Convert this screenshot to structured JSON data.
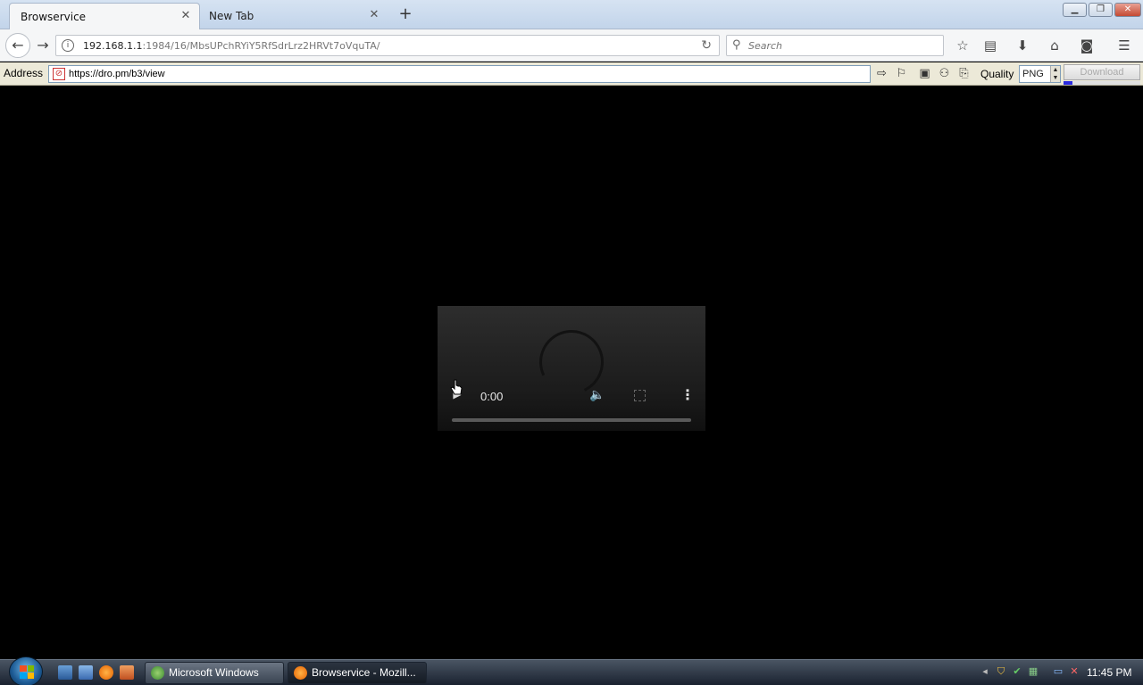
{
  "tabs": [
    {
      "label": "Browservice"
    },
    {
      "label": "New Tab"
    }
  ],
  "navbar": {
    "url_host": "192.168.1.1",
    "url_path": ":1984/16/MbsUPchRYiY5RfSdrLrz2HRVt7oVquTA/",
    "search_placeholder": "Search"
  },
  "address_toolbar": {
    "label": "Address",
    "url": "https://dro.pm/b3/view",
    "quality_label": "Quality",
    "quality_value": "PNG",
    "download_label": "Download",
    "download_progress": 0.12
  },
  "player": {
    "time": "0:00"
  },
  "taskbar": {
    "buttons": [
      {
        "label": "Microsoft Windows"
      },
      {
        "label": "Browservice - Mozill..."
      }
    ],
    "clock": "11:45 PM"
  },
  "colors": {
    "page_background": "#000000",
    "progress_fill": "#2a2ae0",
    "firefox_orange": "#e66000"
  }
}
